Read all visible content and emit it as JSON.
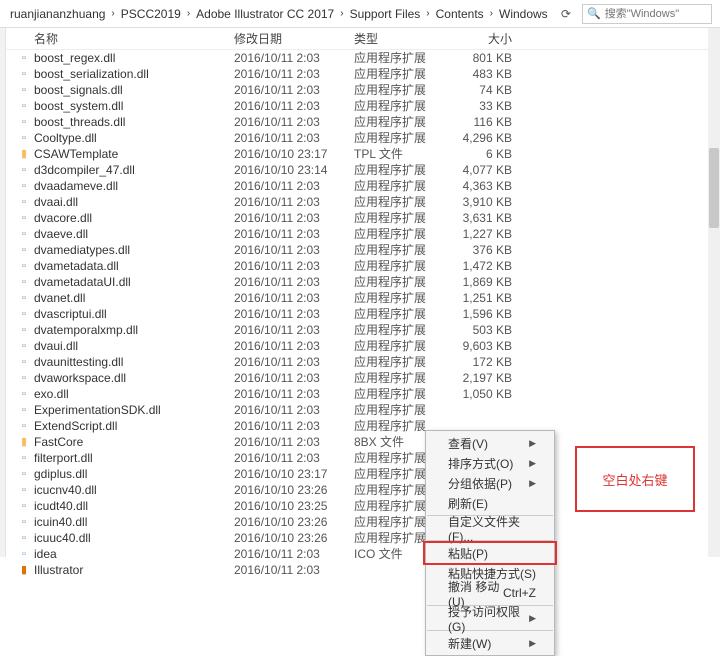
{
  "breadcrumb": [
    "ruanjiananzhuang",
    "PSCC2019",
    "Adobe Illustrator CC 2017",
    "Support Files",
    "Contents",
    "Windows"
  ],
  "search": {
    "placeholder": "搜索\"Windows\""
  },
  "columns": {
    "name": "名称",
    "date": "修改日期",
    "type": "类型",
    "size": "大小"
  },
  "rows": [
    {
      "icon": "dll",
      "name": "boost_regex.dll",
      "date": "2016/10/11 2:03",
      "type": "应用程序扩展",
      "size": "801 KB"
    },
    {
      "icon": "dll",
      "name": "boost_serialization.dll",
      "date": "2016/10/11 2:03",
      "type": "应用程序扩展",
      "size": "483 KB"
    },
    {
      "icon": "dll",
      "name": "boost_signals.dll",
      "date": "2016/10/11 2:03",
      "type": "应用程序扩展",
      "size": "74 KB"
    },
    {
      "icon": "dll",
      "name": "boost_system.dll",
      "date": "2016/10/11 2:03",
      "type": "应用程序扩展",
      "size": "33 KB"
    },
    {
      "icon": "dll",
      "name": "boost_threads.dll",
      "date": "2016/10/11 2:03",
      "type": "应用程序扩展",
      "size": "116 KB"
    },
    {
      "icon": "dll",
      "name": "Cooltype.dll",
      "date": "2016/10/11 2:03",
      "type": "应用程序扩展",
      "size": "4,296 KB"
    },
    {
      "icon": "folder",
      "name": "CSAWTemplate",
      "date": "2016/10/10 23:17",
      "type": "TPL 文件",
      "size": "6 KB"
    },
    {
      "icon": "dll",
      "name": "d3dcompiler_47.dll",
      "date": "2016/10/10 23:14",
      "type": "应用程序扩展",
      "size": "4,077 KB"
    },
    {
      "icon": "dll",
      "name": "dvaadameve.dll",
      "date": "2016/10/11 2:03",
      "type": "应用程序扩展",
      "size": "4,363 KB"
    },
    {
      "icon": "dll",
      "name": "dvaai.dll",
      "date": "2016/10/11 2:03",
      "type": "应用程序扩展",
      "size": "3,910 KB"
    },
    {
      "icon": "dll",
      "name": "dvacore.dll",
      "date": "2016/10/11 2:03",
      "type": "应用程序扩展",
      "size": "3,631 KB"
    },
    {
      "icon": "dll",
      "name": "dvaeve.dll",
      "date": "2016/10/11 2:03",
      "type": "应用程序扩展",
      "size": "1,227 KB"
    },
    {
      "icon": "dll",
      "name": "dvamediatypes.dll",
      "date": "2016/10/11 2:03",
      "type": "应用程序扩展",
      "size": "376 KB"
    },
    {
      "icon": "dll",
      "name": "dvametadata.dll",
      "date": "2016/10/11 2:03",
      "type": "应用程序扩展",
      "size": "1,472 KB"
    },
    {
      "icon": "dll",
      "name": "dvametadataUI.dll",
      "date": "2016/10/11 2:03",
      "type": "应用程序扩展",
      "size": "1,869 KB"
    },
    {
      "icon": "dll",
      "name": "dvanet.dll",
      "date": "2016/10/11 2:03",
      "type": "应用程序扩展",
      "size": "1,251 KB"
    },
    {
      "icon": "dll",
      "name": "dvascriptui.dll",
      "date": "2016/10/11 2:03",
      "type": "应用程序扩展",
      "size": "1,596 KB"
    },
    {
      "icon": "dll",
      "name": "dvatemporalxmp.dll",
      "date": "2016/10/11 2:03",
      "type": "应用程序扩展",
      "size": "503 KB"
    },
    {
      "icon": "dll",
      "name": "dvaui.dll",
      "date": "2016/10/11 2:03",
      "type": "应用程序扩展",
      "size": "9,603 KB"
    },
    {
      "icon": "dll",
      "name": "dvaunittesting.dll",
      "date": "2016/10/11 2:03",
      "type": "应用程序扩展",
      "size": "172 KB"
    },
    {
      "icon": "dll",
      "name": "dvaworkspace.dll",
      "date": "2016/10/11 2:03",
      "type": "应用程序扩展",
      "size": "2,197 KB"
    },
    {
      "icon": "dll",
      "name": "exo.dll",
      "date": "2016/10/11 2:03",
      "type": "应用程序扩展",
      "size": "1,050 KB"
    },
    {
      "icon": "dll",
      "name": "ExperimentationSDK.dll",
      "date": "2016/10/11 2:03",
      "type": "应用程序扩展",
      "size": ""
    },
    {
      "icon": "dll",
      "name": "ExtendScript.dll",
      "date": "2016/10/11 2:03",
      "type": "应用程序扩展",
      "size": ""
    },
    {
      "icon": "folder",
      "name": "FastCore",
      "date": "2016/10/11 2:03",
      "type": "8BX 文件",
      "size": ""
    },
    {
      "icon": "dll",
      "name": "filterport.dll",
      "date": "2016/10/11 2:03",
      "type": "应用程序扩展",
      "size": ""
    },
    {
      "icon": "dll",
      "name": "gdiplus.dll",
      "date": "2016/10/10 23:17",
      "type": "应用程序扩展",
      "size": ""
    },
    {
      "icon": "dll",
      "name": "icucnv40.dll",
      "date": "2016/10/10 23:26",
      "type": "应用程序扩展",
      "size": ""
    },
    {
      "icon": "dll",
      "name": "icudt40.dll",
      "date": "2016/10/10 23:25",
      "type": "应用程序扩展",
      "size": ""
    },
    {
      "icon": "dll",
      "name": "icuin40.dll",
      "date": "2016/10/10 23:26",
      "type": "应用程序扩展",
      "size": ""
    },
    {
      "icon": "dll",
      "name": "icuuc40.dll",
      "date": "2016/10/10 23:26",
      "type": "应用程序扩展",
      "size": ""
    },
    {
      "icon": "ico",
      "name": "idea",
      "date": "2016/10/11 2:03",
      "type": "ICO 文件",
      "size": ""
    },
    {
      "icon": "ai",
      "name": "Illustrator",
      "date": "2016/10/11 2:03",
      "type": "",
      "size": ""
    }
  ],
  "context_menu": [
    {
      "label": "查看(V)",
      "arrow": true
    },
    {
      "label": "排序方式(O)",
      "arrow": true
    },
    {
      "label": "分组依据(P)",
      "arrow": true
    },
    {
      "label": "刷新(E)"
    },
    {
      "sep": true
    },
    {
      "label": "自定义文件夹(F)..."
    },
    {
      "sep": true
    },
    {
      "label": "粘贴(P)",
      "highlight": true
    },
    {
      "label": "粘贴快捷方式(S)"
    },
    {
      "label": "撤消 移动(U)",
      "shortcut": "Ctrl+Z"
    },
    {
      "sep": true
    },
    {
      "label": "授予访问权限(G)",
      "arrow": true
    },
    {
      "sep": true
    },
    {
      "label": "新建(W)",
      "arrow": true
    }
  ],
  "annotation": "空白处右键"
}
